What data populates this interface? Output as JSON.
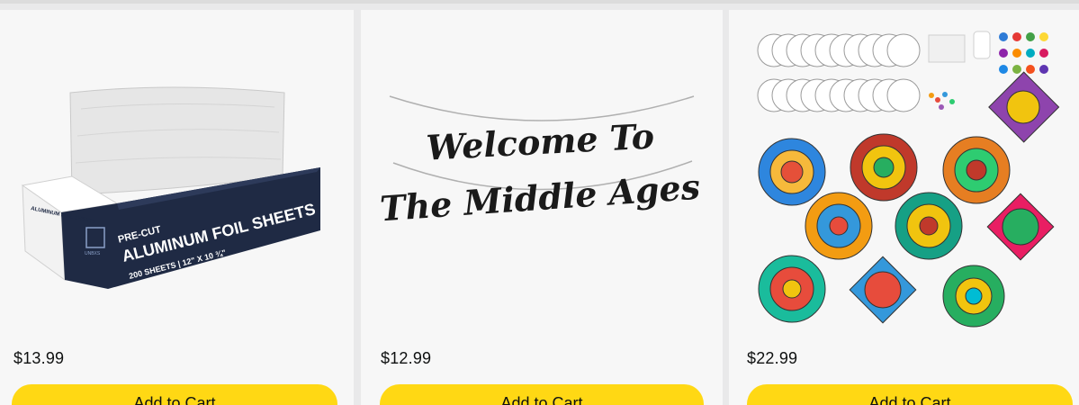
{
  "products": [
    {
      "image_text": {
        "line1": "PRE-CUT",
        "line2": "ALUMINUM FOIL SHEETS",
        "line3": "200 SHEETS | 12\" X 10 ¾\"",
        "brand": "UNBXS",
        "side": "ALUMINUM FOIL SHEETS"
      },
      "price": "$13.99",
      "button_label": "Add to Cart"
    },
    {
      "image_text": {
        "line1": "Welcome To",
        "line2": "The Middle Ages"
      },
      "price": "$12.99",
      "button_label": "Add to Cart"
    },
    {
      "price": "$22.99",
      "button_label": "Add to Cart"
    }
  ],
  "colors": {
    "button_bg": "#ffd814",
    "card_bg": "#f7f7f7",
    "page_bg": "#e9e9ea"
  }
}
